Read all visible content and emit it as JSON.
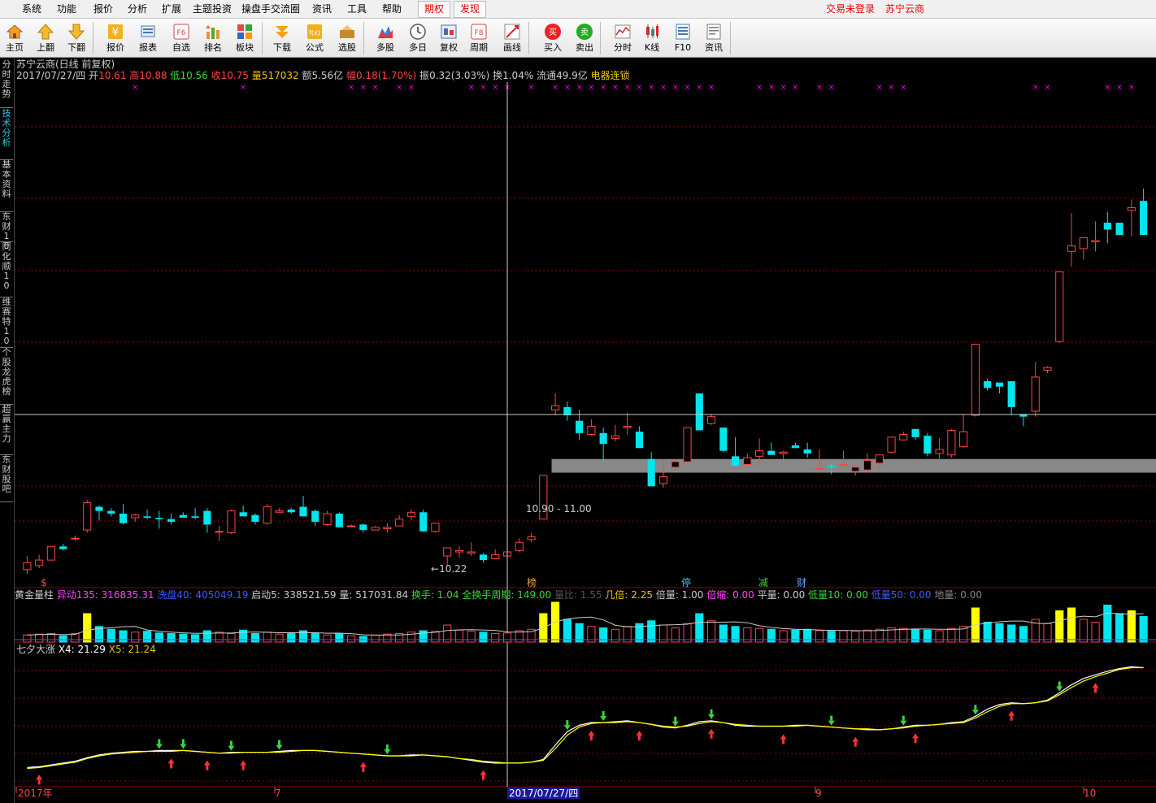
{
  "menubar": {
    "items": [
      "系统",
      "功能",
      "报价",
      "分析",
      "扩展",
      "主题投资",
      "操盘手交流圈",
      "资讯",
      "工具",
      "帮助"
    ],
    "boxed": [
      "期权",
      "发现"
    ],
    "right": [
      "交易未登录",
      "苏宁云商"
    ]
  },
  "toolbar": {
    "buttons": [
      {
        "label": "主页",
        "icon": "home-icon"
      },
      {
        "label": "上翻",
        "icon": "arrow-up-icon"
      },
      {
        "label": "下翻",
        "icon": "arrow-down-icon"
      },
      {
        "label": "报价",
        "icon": "yen-icon"
      },
      {
        "label": "报表",
        "icon": "report-icon"
      },
      {
        "label": "自选",
        "icon": "f6-icon"
      },
      {
        "label": "排名",
        "icon": "rank-icon"
      },
      {
        "label": "板块",
        "icon": "sector-icon"
      },
      {
        "label": "下载",
        "icon": "download-icon"
      },
      {
        "label": "公式",
        "icon": "formula-icon"
      },
      {
        "label": "选股",
        "icon": "stock-pick-icon"
      },
      {
        "label": "多股",
        "icon": "multi-stock-icon"
      },
      {
        "label": "多日",
        "icon": "clock-icon"
      },
      {
        "label": "复权",
        "icon": "rights-icon"
      },
      {
        "label": "周期",
        "icon": "f8-icon"
      },
      {
        "label": "画线",
        "icon": "draw-line-icon"
      },
      {
        "label": "买入",
        "icon": "buy-icon"
      },
      {
        "label": "卖出",
        "icon": "sell-icon"
      },
      {
        "label": "分时",
        "icon": "intraday-icon"
      },
      {
        "label": "K线",
        "icon": "kline-icon"
      },
      {
        "label": "F10",
        "icon": "f10-icon"
      },
      {
        "label": "资讯",
        "icon": "news-icon"
      }
    ],
    "buy_glyph": "买",
    "sell_glyph": "卖",
    "f6_glyph": "F6",
    "f8_glyph": "F8",
    "yen_glyph": "¥",
    "fx_glyph": "f(x)"
  },
  "sidetabs": [
    {
      "label": "分时走势",
      "active": false
    },
    {
      "label": "技术分析",
      "active": true
    },
    {
      "label": "基本资料",
      "active": false
    },
    {
      "label": "东财10",
      "active": false
    },
    {
      "label": "同化顺10",
      "active": false
    },
    {
      "label": "维赛特10",
      "active": false
    },
    {
      "label": "个股龙虎榜",
      "active": false
    },
    {
      "label": "超赢主力",
      "active": false
    },
    {
      "label": "东财股吧",
      "active": false
    }
  ],
  "chart": {
    "title": "苏宁云商(日线 前复权)",
    "date": "2017/07/27/四",
    "stats": [
      {
        "label": "开",
        "value": "10.61"
      },
      {
        "label": "高",
        "value": "10.88"
      },
      {
        "label": "低",
        "value": "10.56"
      },
      {
        "label": "收",
        "value": "10.75"
      },
      {
        "label": "量",
        "value": "517032"
      },
      {
        "label": "额",
        "value": "5.56亿"
      },
      {
        "label": "幅",
        "value": "0.18(1.70%)"
      },
      {
        "label": "振",
        "value": "0.32(3.03%)"
      },
      {
        "label": "换",
        "value": "1.04%"
      },
      {
        "label": "流通",
        "value": "49.9亿"
      }
    ],
    "concept": "电器连锁",
    "low_annotation": "10.22",
    "support_annotation": "10.90 - 11.00",
    "event_markers": [
      "$",
      "榜",
      "停",
      "减",
      "财"
    ],
    "crosshair_date": "2017/07/27/四",
    "x_axis_labels": [
      "2017年",
      "7",
      "9",
      "10"
    ]
  },
  "volume_panel": {
    "title": "黄金量柱",
    "fields": [
      {
        "label": "异动135",
        "value": "316835.31"
      },
      {
        "label": "洗盘40",
        "value": "405049.19"
      },
      {
        "label": "启动5",
        "value": "338521.59"
      },
      {
        "label": "量",
        "value": "517031.84"
      },
      {
        "label": "换手",
        "value": "1.04"
      },
      {
        "label": "全换手周期",
        "value": "149.00"
      },
      {
        "label": "量比",
        "value": "1.55"
      },
      {
        "label": "几倍",
        "value": "2.25"
      },
      {
        "label": "倍量",
        "value": "1.00"
      },
      {
        "label": "倍缩",
        "value": "0.00"
      },
      {
        "label": "平量",
        "value": "0.00"
      },
      {
        "label": "低量10",
        "value": "0.00"
      },
      {
        "label": "低量50",
        "value": "0.00"
      },
      {
        "label": "地量",
        "value": "0.00"
      }
    ]
  },
  "osc_panel": {
    "title": "七夕大涨",
    "fields": [
      {
        "label": "X4",
        "value": "21.29"
      },
      {
        "label": "X5",
        "value": "21.24"
      }
    ]
  },
  "colors": {
    "up": "#ff4444",
    "down": "#00e5ee",
    "grid": "#8b0000",
    "crosshair": "#cccccc",
    "ma_white": "#ffffff",
    "ma_yellow": "#ffff00",
    "support_bar": "#888888",
    "marker_magenta": "#ff00ff"
  },
  "chart_data": {
    "type": "candlestick",
    "title": "苏宁云商(日线 前复权)",
    "x": [
      "2017年",
      "7",
      "9",
      "10"
    ],
    "selected": {
      "date": "2017/07/27/四",
      "open": 10.61,
      "high": 10.88,
      "low": 10.56,
      "close": 10.75,
      "volume": 517032
    },
    "price_range": [
      10.1,
      13.7
    ],
    "candles_ohlc": [
      [
        10.19,
        10.29,
        10.16,
        10.24
      ],
      [
        10.22,
        10.3,
        10.2,
        10.26
      ],
      [
        10.26,
        10.36,
        10.26,
        10.36
      ],
      [
        10.36,
        10.38,
        10.33,
        10.34
      ],
      [
        10.42,
        10.44,
        10.4,
        10.42
      ],
      [
        10.48,
        10.7,
        10.46,
        10.68
      ],
      [
        10.65,
        10.66,
        10.55,
        10.62
      ],
      [
        10.62,
        10.64,
        10.58,
        10.6
      ],
      [
        10.6,
        10.67,
        10.52,
        10.53
      ],
      [
        10.57,
        10.6,
        10.54,
        10.59
      ],
      [
        10.58,
        10.63,
        10.56,
        10.57
      ],
      [
        10.57,
        10.62,
        10.49,
        10.56
      ],
      [
        10.56,
        10.6,
        10.52,
        10.54
      ],
      [
        10.59,
        10.61,
        10.57,
        10.57
      ],
      [
        10.58,
        10.64,
        10.56,
        10.57
      ],
      [
        10.62,
        10.64,
        10.46,
        10.52
      ],
      [
        10.47,
        10.51,
        10.4,
        10.47
      ],
      [
        10.46,
        10.63,
        10.45,
        10.62
      ],
      [
        10.61,
        10.66,
        10.58,
        10.58
      ],
      [
        10.59,
        10.6,
        10.52,
        10.54
      ],
      [
        10.53,
        10.67,
        10.52,
        10.65
      ],
      [
        10.61,
        10.64,
        10.61,
        10.62
      ],
      [
        10.63,
        10.64,
        10.6,
        10.61
      ],
      [
        10.65,
        10.73,
        10.58,
        10.58
      ],
      [
        10.62,
        10.63,
        10.51,
        10.54
      ],
      [
        10.52,
        10.62,
        10.51,
        10.6
      ],
      [
        10.6,
        10.61,
        10.5,
        10.5
      ],
      [
        10.51,
        10.52,
        10.5,
        10.51
      ],
      [
        10.52,
        10.53,
        10.46,
        10.48
      ],
      [
        10.48,
        10.51,
        10.48,
        10.5
      ],
      [
        10.49,
        10.53,
        10.46,
        10.5
      ],
      [
        10.51,
        10.59,
        10.51,
        10.56
      ],
      [
        10.58,
        10.63,
        10.55,
        10.61
      ],
      [
        10.61,
        10.63,
        10.47,
        10.47
      ],
      [
        10.47,
        10.53,
        10.46,
        10.53
      ],
      [
        10.29,
        10.33,
        10.22,
        10.35
      ],
      [
        10.32,
        10.36,
        10.28,
        10.33
      ],
      [
        10.31,
        10.39,
        10.29,
        10.32
      ],
      [
        10.3,
        10.31,
        10.24,
        10.26
      ],
      [
        10.27,
        10.34,
        10.27,
        10.3
      ],
      [
        10.29,
        10.35,
        10.27,
        10.32
      ],
      [
        10.33,
        10.42,
        10.32,
        10.39
      ],
      [
        10.41,
        10.46,
        10.39,
        10.43
      ],
      [
        10.56,
        10.88,
        10.56,
        10.88
      ],
      [
        11.36,
        11.48,
        11.32,
        11.39
      ],
      [
        11.38,
        11.42,
        11.28,
        11.32
      ],
      [
        11.28,
        11.36,
        11.14,
        11.19
      ],
      [
        11.18,
        11.29,
        11.17,
        11.24
      ],
      [
        11.19,
        11.23,
        10.99,
        11.11
      ],
      [
        11.15,
        11.25,
        11.13,
        11.17
      ],
      [
        11.23,
        11.34,
        11.18,
        11.24
      ],
      [
        11.2,
        11.24,
        11.14,
        11.08
      ],
      [
        11.0,
        11.05,
        10.81,
        10.8
      ],
      [
        10.82,
        10.99,
        10.79,
        10.87
      ],
      [
        10.94,
        11.0,
        10.92,
        10.98
      ],
      [
        10.98,
        11.2,
        10.97,
        11.23
      ],
      [
        11.48,
        11.48,
        11.21,
        11.21
      ],
      [
        11.26,
        11.33,
        11.25,
        11.31
      ],
      [
        11.23,
        11.23,
        11.05,
        11.06
      ],
      [
        11.02,
        11.16,
        10.98,
        10.95
      ],
      [
        10.96,
        11.04,
        10.96,
        11.01
      ],
      [
        11.02,
        11.15,
        10.96,
        11.06
      ],
      [
        11.06,
        11.12,
        11.03,
        11.03
      ],
      [
        11.04,
        11.06,
        11.0,
        11.05
      ],
      [
        11.1,
        11.12,
        11.08,
        11.08
      ],
      [
        11.07,
        11.12,
        11.01,
        11.04
      ],
      [
        10.93,
        11.07,
        10.91,
        10.93
      ],
      [
        10.95,
        10.97,
        10.89,
        10.94
      ],
      [
        10.96,
        11.06,
        10.94,
        10.96
      ],
      [
        10.91,
        10.96,
        10.88,
        10.94
      ],
      [
        10.92,
        11.04,
        10.91,
        10.99
      ],
      [
        10.97,
        11.03,
        10.93,
        11.03
      ],
      [
        11.05,
        11.16,
        11.04,
        11.16
      ],
      [
        11.14,
        11.2,
        11.14,
        11.18
      ],
      [
        11.22,
        11.22,
        11.14,
        11.16
      ],
      [
        11.17,
        11.19,
        11.02,
        11.04
      ],
      [
        11.04,
        11.15,
        10.98,
        11.07
      ],
      [
        11.03,
        11.22,
        11.01,
        11.21
      ],
      [
        11.09,
        11.33,
        11.08,
        11.2
      ],
      [
        11.32,
        11.8,
        11.31,
        11.84
      ],
      [
        11.57,
        11.59,
        11.5,
        11.52
      ],
      [
        11.56,
        11.56,
        11.48,
        11.53
      ],
      [
        11.57,
        11.55,
        11.32,
        11.38
      ],
      [
        11.33,
        11.33,
        11.24,
        11.31
      ],
      [
        11.35,
        11.71,
        11.31,
        11.6
      ],
      [
        11.65,
        11.68,
        11.63,
        11.67
      ],
      [
        11.86,
        12.36,
        11.85,
        12.37
      ],
      [
        12.52,
        12.8,
        12.41,
        12.56
      ],
      [
        12.54,
        12.55,
        12.46,
        12.62
      ],
      [
        12.59,
        12.74,
        12.52,
        12.6
      ],
      [
        12.73,
        12.81,
        12.58,
        12.68
      ],
      [
        12.73,
        12.69,
        12.64,
        12.64
      ],
      [
        12.82,
        12.9,
        12.63,
        12.84
      ],
      [
        12.89,
        12.98,
        12.66,
        12.64
      ]
    ],
    "volume": [
      0.25,
      0.28,
      0.3,
      0.22,
      0.3,
      1.0,
      0.55,
      0.45,
      0.4,
      0.35,
      0.38,
      0.32,
      0.3,
      0.28,
      0.26,
      0.4,
      0.35,
      0.3,
      0.42,
      0.3,
      0.35,
      0.28,
      0.3,
      0.4,
      0.32,
      0.25,
      0.3,
      0.22,
      0.2,
      0.25,
      0.28,
      0.3,
      0.35,
      0.4,
      0.38,
      0.6,
      0.42,
      0.38,
      0.35,
      0.3,
      0.32,
      0.4,
      0.45,
      1.0,
      1.4,
      0.8,
      0.65,
      0.55,
      0.5,
      0.45,
      0.55,
      0.65,
      0.75,
      0.6,
      0.5,
      0.65,
      1.0,
      0.75,
      0.6,
      0.55,
      0.5,
      0.48,
      0.45,
      0.4,
      0.42,
      0.45,
      0.4,
      0.38,
      0.4,
      0.38,
      0.42,
      0.45,
      0.5,
      0.48,
      0.45,
      0.42,
      0.4,
      0.48,
      0.55,
      1.2,
      0.7,
      0.65,
      0.6,
      0.55,
      0.8,
      0.65,
      1.1,
      1.2,
      0.8,
      0.7,
      1.3,
      1.0,
      1.1,
      0.9
    ],
    "osc_x4": [
      21.05,
      21.06,
      21.08,
      21.1,
      21.12,
      21.16,
      21.19,
      21.21,
      21.22,
      21.23,
      21.23,
      21.24,
      21.24,
      21.24,
      21.23,
      21.22,
      21.21,
      21.22,
      21.22,
      21.22,
      21.22,
      21.23,
      21.24,
      21.24,
      21.24,
      21.23,
      21.22,
      21.21,
      21.2,
      21.19,
      21.18,
      21.18,
      21.19,
      21.19,
      21.18,
      21.17,
      21.15,
      21.13,
      21.11,
      21.1,
      21.1,
      21.1,
      21.11,
      21.14,
      21.3,
      21.45,
      21.52,
      21.55,
      21.55,
      21.56,
      21.57,
      21.55,
      21.53,
      21.5,
      21.49,
      21.52,
      21.56,
      21.57,
      21.55,
      21.52,
      21.51,
      21.51,
      21.51,
      21.51,
      21.52,
      21.52,
      21.51,
      21.5,
      21.49,
      21.48,
      21.47,
      21.47,
      21.48,
      21.5,
      21.52,
      21.52,
      21.53,
      21.55,
      21.56,
      21.62,
      21.7,
      21.75,
      21.77,
      21.76,
      21.77,
      21.8,
      21.88,
      21.97,
      22.04,
      22.08,
      22.12,
      22.15,
      22.17,
      22.16
    ],
    "osc_x5": [
      21.04,
      21.05,
      21.07,
      21.09,
      21.11,
      21.15,
      21.18,
      21.2,
      21.21,
      21.22,
      21.23,
      21.23,
      21.23,
      21.24,
      21.23,
      21.22,
      21.21,
      21.21,
      21.22,
      21.22,
      21.22,
      21.22,
      21.23,
      21.24,
      21.24,
      21.23,
      21.22,
      21.21,
      21.2,
      21.19,
      21.18,
      21.18,
      21.18,
      21.19,
      21.18,
      21.17,
      21.15,
      21.14,
      21.12,
      21.11,
      21.1,
      21.1,
      21.11,
      21.13,
      21.26,
      21.41,
      21.5,
      21.54,
      21.55,
      21.55,
      21.56,
      21.55,
      21.53,
      21.51,
      21.5,
      21.51,
      21.54,
      21.56,
      21.55,
      21.53,
      21.52,
      21.51,
      21.51,
      21.51,
      21.51,
      21.52,
      21.51,
      21.5,
      21.49,
      21.48,
      21.48,
      21.47,
      21.48,
      21.49,
      21.51,
      21.52,
      21.53,
      21.54,
      21.55,
      21.6,
      21.67,
      21.73,
      21.76,
      21.76,
      21.77,
      21.79,
      21.86,
      21.94,
      22.01,
      22.06,
      22.1,
      22.14,
      22.16,
      22.16
    ],
    "osc_range": [
      20.9,
      22.3
    ],
    "green_arrow_idx": [
      11,
      13,
      17,
      21,
      30,
      45,
      48,
      54,
      57,
      67,
      73,
      79,
      86
    ],
    "red_arrow_idx": [
      1,
      12,
      15,
      18,
      28,
      38,
      47,
      51,
      57,
      63,
      69,
      74,
      82,
      89
    ],
    "magenta_marker_idx": [
      9,
      18,
      27,
      28,
      29,
      31,
      32,
      37,
      38,
      39,
      40,
      42,
      44,
      45,
      46,
      47,
      48,
      49,
      50,
      51,
      52,
      53,
      54,
      55,
      56,
      57,
      61,
      62,
      63,
      64,
      66,
      67,
      71,
      72,
      73,
      84,
      85,
      90,
      91,
      92
    ],
    "selected_index": 38
  }
}
